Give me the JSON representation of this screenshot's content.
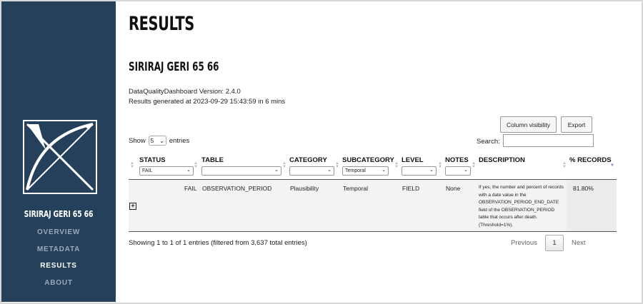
{
  "sidebar": {
    "site_title": "SIRIRAJ GERI 65 66",
    "nav": [
      {
        "label": "OVERVIEW",
        "active": false
      },
      {
        "label": "METADATA",
        "active": false
      },
      {
        "label": "RESULTS",
        "active": true
      },
      {
        "label": "ABOUT",
        "active": false
      }
    ],
    "colors": {
      "background": "#24405a",
      "active": "#ffffff",
      "inactive": "#9aa9b8"
    }
  },
  "main": {
    "page_title": "RESULTS",
    "db_title": "SIRIRAJ GERI 65 66",
    "version_line": "DataQualityDashboard Version: 2.4.0",
    "generated_line": "Results generated at 2023-09-29 15:43:59 in 6 mins"
  },
  "toolbar": {
    "column_visibility_label": "Column visibility",
    "export_label": "Export",
    "show_prefix": "Show",
    "page_length": "5",
    "show_suffix": "entries",
    "search_label": "Search:",
    "search_value": ""
  },
  "table": {
    "columns": [
      {
        "label": "STATUS",
        "filter": "FAIL"
      },
      {
        "label": "TABLE",
        "filter": ""
      },
      {
        "label": "CATEGORY",
        "filter": ""
      },
      {
        "label": "SUBCATEGORY",
        "filter": "Temporal"
      },
      {
        "label": "LEVEL",
        "filter": ""
      },
      {
        "label": "NOTES",
        "filter": ""
      },
      {
        "label": "DESCRIPTION"
      },
      {
        "label": "% RECORDS"
      }
    ],
    "rows": [
      {
        "status": "FAIL",
        "table": "OBSERVATION_PERIOD",
        "category": "Plausibility",
        "subcategory": "Temporal",
        "level": "FIELD",
        "notes": "None",
        "description": "If yes, the number and percent of records with a date value in the OBSERVATION_PERIOD_END_DATE field of the OBSERVATION_PERIOD table that occurs after death. (Threshold=1%).",
        "pct_records": "81.80%"
      }
    ]
  },
  "footer": {
    "info": "Showing 1 to 1 of 1 entries (filtered from 3,637 total entries)",
    "previous_label": "Previous",
    "current_page": "1",
    "next_label": "Next"
  },
  "icons": {
    "expand": "plus-square-icon",
    "logo": "x-arrow-logo-icon"
  }
}
